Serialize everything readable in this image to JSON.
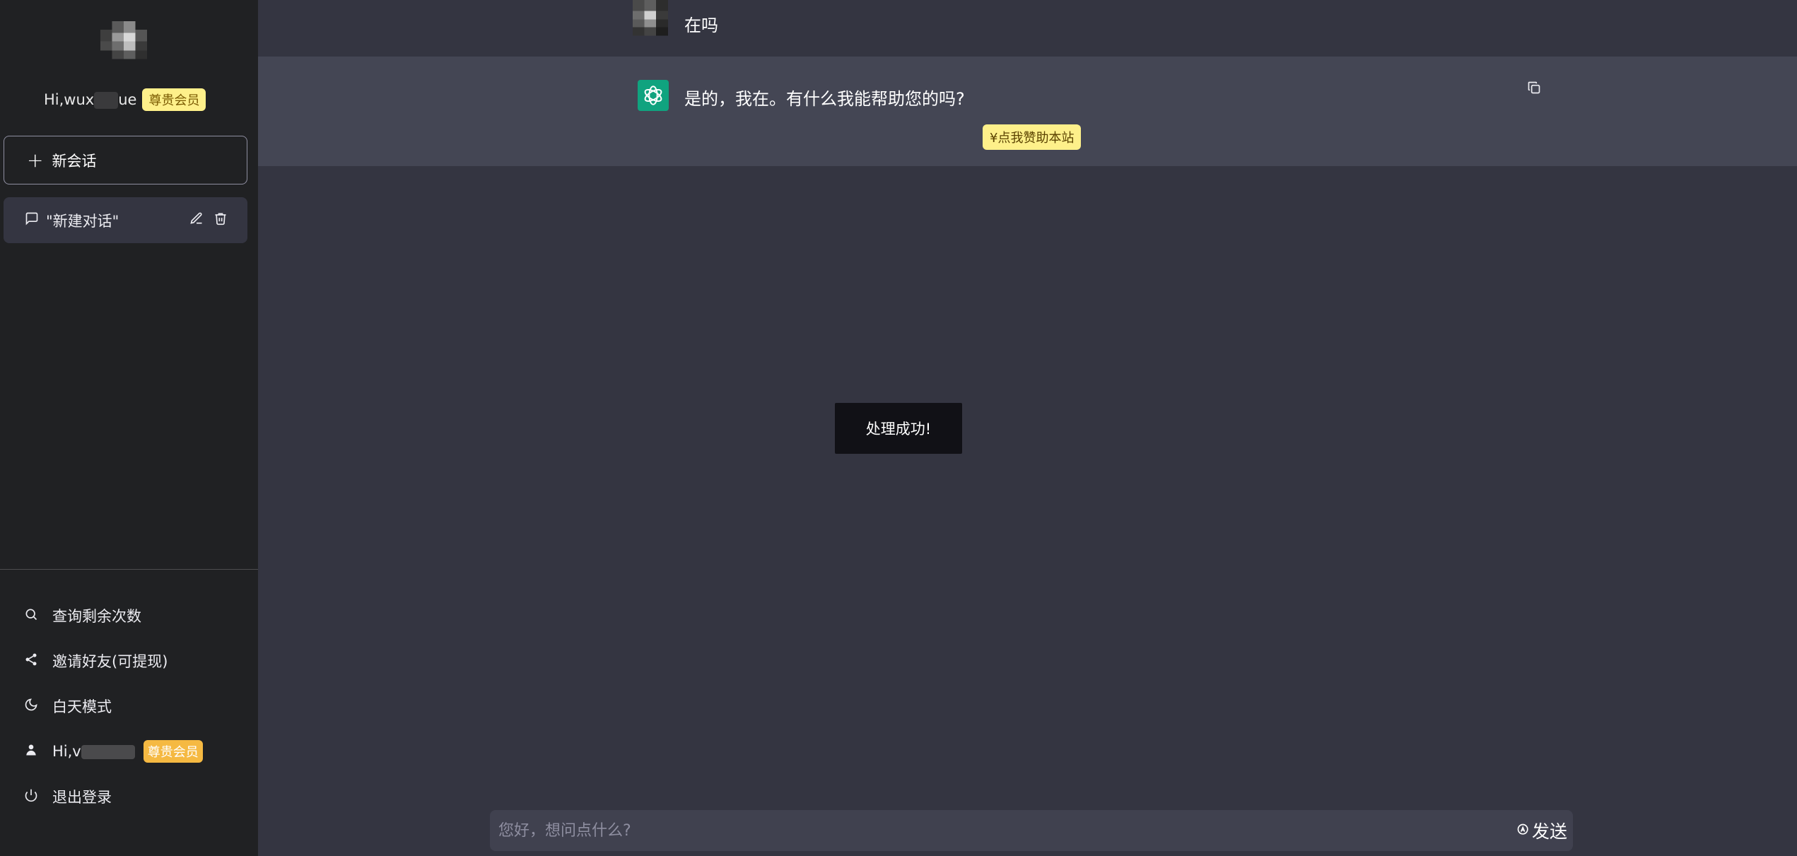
{
  "sidebar": {
    "user_name_visible_prefix": "Hi,wux",
    "user_name_visible_suffix": "ue",
    "user_badge": "尊贵会员",
    "new_chat_label": "新会话",
    "conversations": [
      {
        "title": "\"新建对话\""
      }
    ],
    "menu": {
      "query_remaining": "查询剩余次数",
      "invite_friends": "邀请好友(可提现)",
      "day_mode": "白天模式",
      "user_greeting": "Hi,v",
      "user_badge": "尊贵会员",
      "logout": "退出登录"
    }
  },
  "chat": {
    "user_message": "在吗",
    "bot_message": "是的，我在。有什么我能帮助您的吗?",
    "donate_label": "¥点我赞助本站"
  },
  "toast": {
    "message": "处理成功!"
  },
  "composer": {
    "placeholder": "您好，想问点什么?",
    "send_label": "发送"
  },
  "colors": {
    "sidebar_bg": "#202123",
    "main_bg": "#343541",
    "bot_row_bg": "#444654",
    "brand_green": "#10a37f",
    "badge_yellow": "#fef08a",
    "badge_orange": "#f5b942"
  }
}
